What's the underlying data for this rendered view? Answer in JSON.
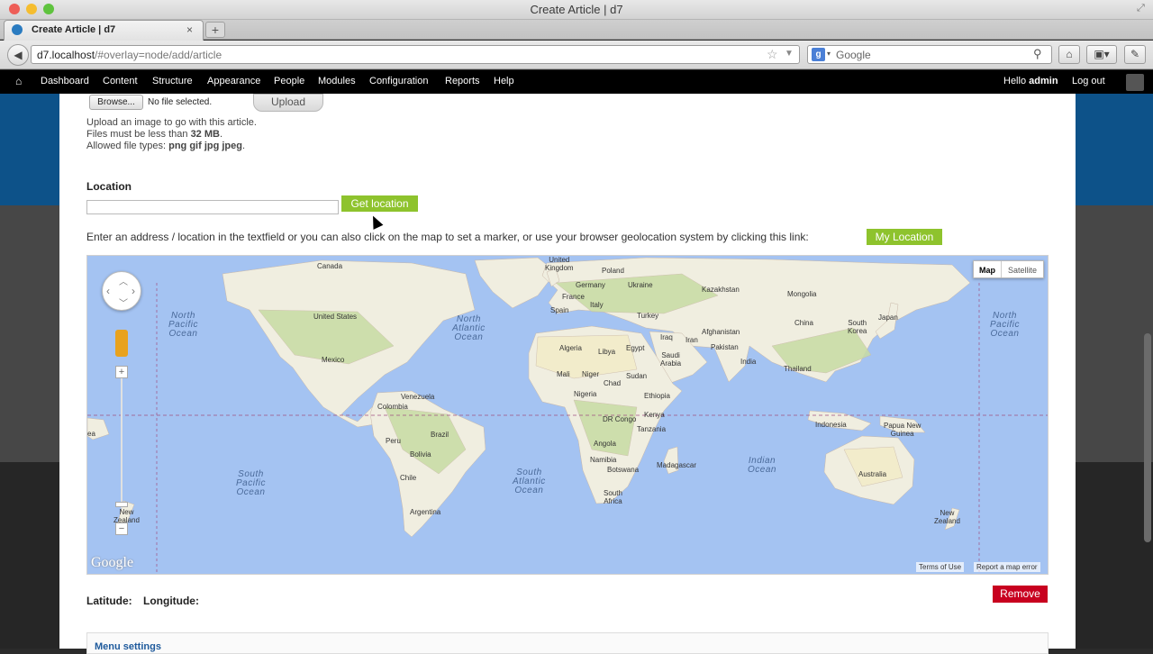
{
  "window": {
    "title": "Create Article | d7"
  },
  "tab": {
    "title": "Create Article | d7",
    "close": "×",
    "new_tab": "+"
  },
  "nav": {
    "url_host": "d7.localhost",
    "url_path": "/#overlay=node/add/article",
    "search_placeholder": "Google",
    "back_icon": "back-arrow-icon"
  },
  "toolbar": {
    "items": [
      "Dashboard",
      "Content",
      "Structure",
      "Appearance",
      "People",
      "Modules",
      "Configuration",
      "Reports",
      "Help"
    ],
    "hello": "Hello",
    "user": "admin",
    "logout": "Log out"
  },
  "image_field": {
    "browse": "Browse...",
    "file_status": "No file selected.",
    "upload": "Upload",
    "help1": "Upload an image to go with this article.",
    "help2_prefix": "Files must be less than ",
    "help2_value": "32 MB",
    "help2_suffix": ".",
    "help3_prefix": "Allowed file types: ",
    "help3_value": "png gif jpg jpeg",
    "help3_suffix": "."
  },
  "location": {
    "label": "Location",
    "input_value": "",
    "get_location": "Get location",
    "instructions": "Enter an address / location in the textfield or you can also click on the map to set a marker, or use your browser geolocation system by clicking this link:",
    "my_location": "My Location"
  },
  "map": {
    "type_map": "Map",
    "type_satellite": "Satellite",
    "zoom_in": "+",
    "zoom_out": "−",
    "logo": "Google",
    "terms": "Terms of Use",
    "report": "Report a map error",
    "colors": {
      "water": "#a4c3f2",
      "land": "#f0eee0",
      "green": "#c8dca4",
      "desert": "#f3ecc8"
    },
    "labels": {
      "canada": "Canada",
      "united_states": "United States",
      "mexico": "Mexico",
      "venezuela": "Venezuela",
      "colombia": "Colombia",
      "peru": "Peru",
      "brazil": "Brazil",
      "bolivia": "Bolivia",
      "chile": "Chile",
      "argentina": "Argentina",
      "united_kingdom": "United\nKingdom",
      "poland": "Poland",
      "germany": "Germany",
      "ukraine": "Ukraine",
      "france": "France",
      "spain": "Spain",
      "italy": "Italy",
      "turkey": "Turkey",
      "kazakhstan": "Kazakhstan",
      "mongolia": "Mongolia",
      "china": "China",
      "south_korea": "South\nKorea",
      "japan": "Japan",
      "afghanistan": "Afghanistan",
      "pakistan": "Pakistan",
      "iran": "Iran",
      "iraq": "Iraq",
      "india": "India",
      "thailand": "Thailand",
      "saudi_arabia": "Saudi\nArabia",
      "algeria": "Algeria",
      "libya": "Libya",
      "egypt": "Egypt",
      "mali": "Mali",
      "niger": "Niger",
      "chad": "Chad",
      "sudan": "Sudan",
      "nigeria": "Nigeria",
      "ethiopia": "Ethiopia",
      "dr_congo": "DR Congo",
      "kenya": "Kenya",
      "tanzania": "Tanzania",
      "angola": "Angola",
      "namibia": "Namibia",
      "botswana": "Botswana",
      "madagascar": "Madagascar",
      "south_africa": "South\nAfrica",
      "indonesia": "Indonesia",
      "papua_new_guinea": "Papua New\nGuinea",
      "australia": "Australia",
      "new_zealand_left": "New\nZealand",
      "new_zealand": "New\nZealand",
      "ea": "ea"
    },
    "oceans": {
      "north_pacific_left": "North\nPacific\nOcean",
      "north_atlantic": "North\nAtlantic\nOcean",
      "north_pacific_right": "North\nPacific\nOcean",
      "south_pacific": "South\nPacific\nOcean",
      "south_atlantic": "South\nAtlantic\nOcean",
      "indian": "Indian\nOcean"
    }
  },
  "coords": {
    "latitude": "Latitude:",
    "longitude": "Longitude:"
  },
  "remove": "Remove",
  "menu_settings": "Menu settings"
}
